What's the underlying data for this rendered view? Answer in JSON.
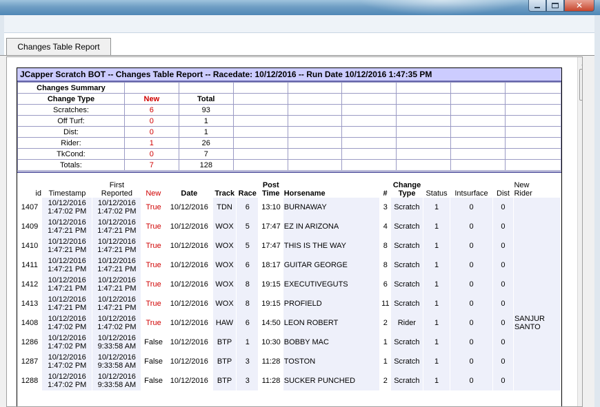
{
  "window": {
    "minimize_icon": "minimize-icon",
    "maximize_icon": "maximize-icon",
    "close_icon": "close-icon",
    "close_glyph": "✕"
  },
  "tabs": [
    {
      "label": "Changes Table Report"
    }
  ],
  "report": {
    "title": "JCapper Scratch BOT -- Changes Table Report -- Racedate: 10/12/2016  -- Run Date 10/12/2016 1:47:35 PM"
  },
  "summary": {
    "heading": "Changes Summary",
    "headers": {
      "type": "Change Type",
      "new": "New",
      "total": "Total"
    },
    "rows": [
      {
        "type": "Scratches:",
        "new": "6",
        "total": "93"
      },
      {
        "type": "Off Turf:",
        "new": "0",
        "total": "1"
      },
      {
        "type": "Dist:",
        "new": "0",
        "total": "1"
      },
      {
        "type": "Rider:",
        "new": "1",
        "total": "26"
      },
      {
        "type": "TkCond:",
        "new": "0",
        "total": "7"
      },
      {
        "type": "Totals:",
        "new": "7",
        "total": "128"
      }
    ]
  },
  "changes": {
    "headers": {
      "id": "id",
      "timestamp": "Timestamp",
      "first_reported_1": "First",
      "first_reported_2": "Reported",
      "new": "New",
      "date": "Date",
      "track": "Track",
      "race": "Race",
      "post_1": "Post",
      "post_2": "Time",
      "horsename": "Horsename",
      "num": "#",
      "change_type_1": "Change",
      "change_type_2": "Type",
      "status": "Status",
      "intsurface": "Intsurface",
      "dist": "Dist",
      "new_rider_1": "New",
      "new_rider_2": "Rider"
    },
    "rows": [
      {
        "id": "1407",
        "ts_date": "10/12/2016",
        "ts_time": "1:47:02 PM",
        "fr_date": "10/12/2016",
        "fr_time": "1:47:02 PM",
        "new": "True",
        "date": "10/12/2016",
        "track": "TDN",
        "race": "6",
        "post": "13:10",
        "horse": "BURNAWAY",
        "num": "3",
        "type": "Scratch",
        "status": "1",
        "intsurface": "0",
        "dist": "0",
        "rider_1": "",
        "rider_2": ""
      },
      {
        "id": "1409",
        "ts_date": "10/12/2016",
        "ts_time": "1:47:21 PM",
        "fr_date": "10/12/2016",
        "fr_time": "1:47:21 PM",
        "new": "True",
        "date": "10/12/2016",
        "track": "WOX",
        "race": "5",
        "post": "17:47",
        "horse": "EZ IN ARIZONA",
        "num": "4",
        "type": "Scratch",
        "status": "1",
        "intsurface": "0",
        "dist": "0",
        "rider_1": "",
        "rider_2": ""
      },
      {
        "id": "1410",
        "ts_date": "10/12/2016",
        "ts_time": "1:47:21 PM",
        "fr_date": "10/12/2016",
        "fr_time": "1:47:21 PM",
        "new": "True",
        "date": "10/12/2016",
        "track": "WOX",
        "race": "5",
        "post": "17:47",
        "horse": "THIS IS THE WAY",
        "num": "8",
        "type": "Scratch",
        "status": "1",
        "intsurface": "0",
        "dist": "0",
        "rider_1": "",
        "rider_2": ""
      },
      {
        "id": "1411",
        "ts_date": "10/12/2016",
        "ts_time": "1:47:21 PM",
        "fr_date": "10/12/2016",
        "fr_time": "1:47:21 PM",
        "new": "True",
        "date": "10/12/2016",
        "track": "WOX",
        "race": "6",
        "post": "18:17",
        "horse": "GUITAR GEORGE",
        "num": "8",
        "type": "Scratch",
        "status": "1",
        "intsurface": "0",
        "dist": "0",
        "rider_1": "",
        "rider_2": ""
      },
      {
        "id": "1412",
        "ts_date": "10/12/2016",
        "ts_time": "1:47:21 PM",
        "fr_date": "10/12/2016",
        "fr_time": "1:47:21 PM",
        "new": "True",
        "date": "10/12/2016",
        "track": "WOX",
        "race": "8",
        "post": "19:15",
        "horse": "EXECUTIVEGUTS",
        "num": "6",
        "type": "Scratch",
        "status": "1",
        "intsurface": "0",
        "dist": "0",
        "rider_1": "",
        "rider_2": ""
      },
      {
        "id": "1413",
        "ts_date": "10/12/2016",
        "ts_time": "1:47:21 PM",
        "fr_date": "10/12/2016",
        "fr_time": "1:47:21 PM",
        "new": "True",
        "date": "10/12/2016",
        "track": "WOX",
        "race": "8",
        "post": "19:15",
        "horse": "PROFIELD",
        "num": "11",
        "type": "Scratch",
        "status": "1",
        "intsurface": "0",
        "dist": "0",
        "rider_1": "",
        "rider_2": ""
      },
      {
        "id": "1408",
        "ts_date": "10/12/2016",
        "ts_time": "1:47:02 PM",
        "fr_date": "10/12/2016",
        "fr_time": "1:47:02 PM",
        "new": "True",
        "date": "10/12/2016",
        "track": "HAW",
        "race": "6",
        "post": "14:50",
        "horse": "LEON ROBERT",
        "num": "2",
        "type": "Rider",
        "status": "1",
        "intsurface": "0",
        "dist": "0",
        "rider_1": "SANJUR",
        "rider_2": "SANTO"
      },
      {
        "id": "1286",
        "ts_date": "10/12/2016",
        "ts_time": "1:47:02 PM",
        "fr_date": "10/12/2016",
        "fr_time": "9:33:58 AM",
        "new": "False",
        "date": "10/12/2016",
        "track": "BTP",
        "race": "1",
        "post": "10:30",
        "horse": "BOBBY MAC",
        "num": "1",
        "type": "Scratch",
        "status": "1",
        "intsurface": "0",
        "dist": "0",
        "rider_1": "",
        "rider_2": ""
      },
      {
        "id": "1287",
        "ts_date": "10/12/2016",
        "ts_time": "1:47:02 PM",
        "fr_date": "10/12/2016",
        "fr_time": "9:33:58 AM",
        "new": "False",
        "date": "10/12/2016",
        "track": "BTP",
        "race": "3",
        "post": "11:28",
        "horse": "TOSTON",
        "num": "1",
        "type": "Scratch",
        "status": "1",
        "intsurface": "0",
        "dist": "0",
        "rider_1": "",
        "rider_2": ""
      },
      {
        "id": "1288",
        "ts_date": "10/12/2016",
        "ts_time": "1:47:02 PM",
        "fr_date": "10/12/2016",
        "fr_time": "9:33:58 AM",
        "new": "False",
        "date": "10/12/2016",
        "track": "BTP",
        "race": "3",
        "post": "11:28",
        "horse": "SUCKER PUNCHED",
        "num": "2",
        "type": "Scratch",
        "status": "1",
        "intsurface": "0",
        "dist": "0",
        "rider_1": "",
        "rider_2": ""
      }
    ]
  },
  "scrollbar": {
    "up_icon": "scroll-up-arrow-icon",
    "up_glyph": "▲"
  },
  "colors": {
    "title_bg": "#ccccff",
    "new_true": "#d00000",
    "border": "#6666aa"
  }
}
